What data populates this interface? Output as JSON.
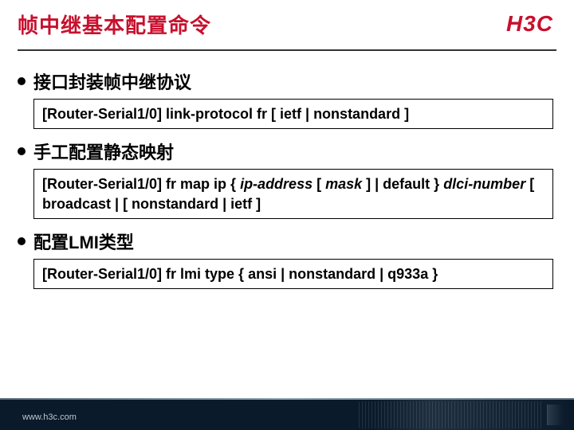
{
  "header": {
    "title": "帧中继基本配置命令",
    "brand": "H3C"
  },
  "bullets": {
    "b1": "接口封装帧中继协议",
    "b2": "手工配置静态映射",
    "b3": "配置LMI类型"
  },
  "commands": {
    "c1": {
      "prefix": "[Router-Serial1/0] link-protocol fr [ ietf | nonstandard ]"
    },
    "c2": {
      "line1a": "[Router-Serial1/0] fr map ip { ",
      "ipaddr": "ip-address",
      "line1b": " [ ",
      "mask": "mask",
      "line1c": " ] | default } ",
      "dlci": "dlci-number",
      "line1d": " [ broadcast | [ nonstandard | ietf ]"
    },
    "c3": {
      "line1": "[Router-Serial1/0] fr lmi type { ansi | nonstandard | q933a }"
    }
  },
  "footer": {
    "url": "www.h3c.com"
  }
}
